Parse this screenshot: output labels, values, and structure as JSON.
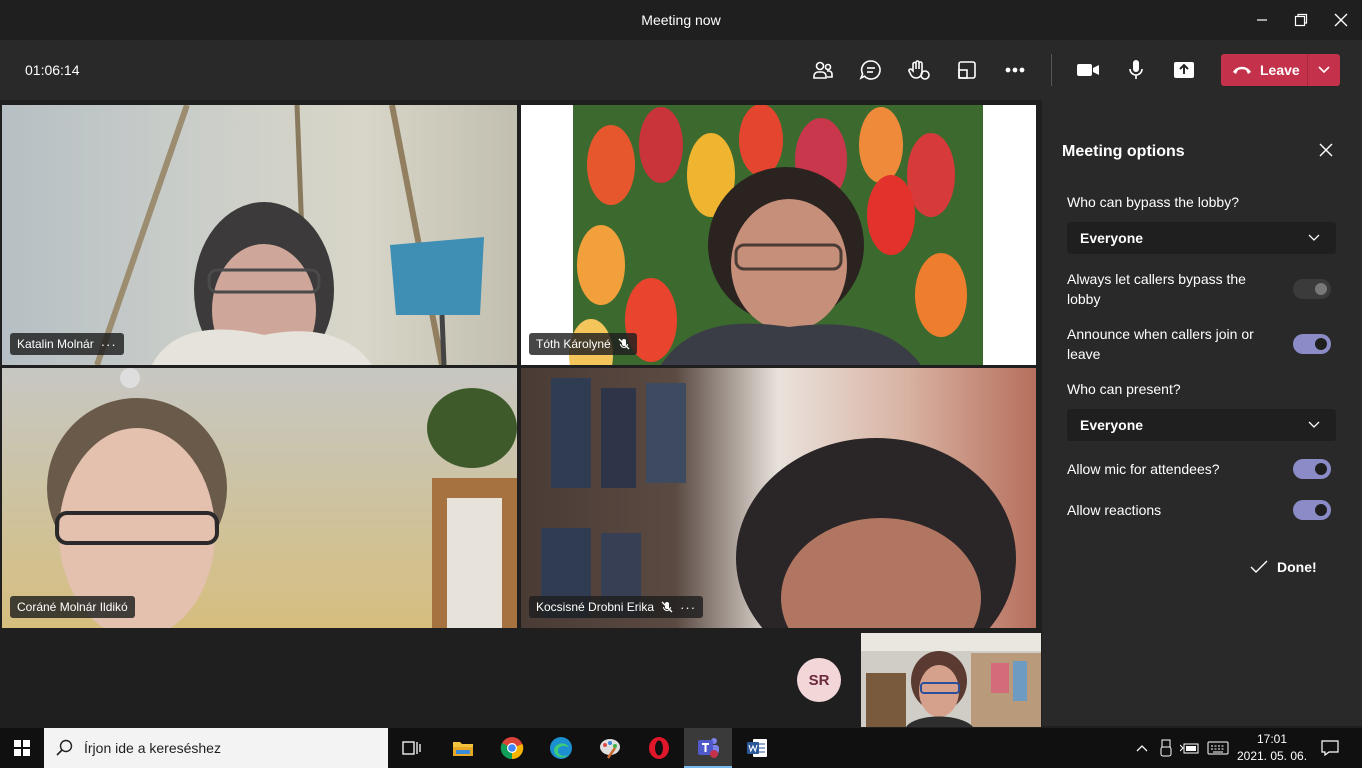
{
  "window": {
    "title": "Meeting now",
    "minimize_icon": "minimize-icon",
    "maximize_icon": "maximize-icon",
    "close_icon": "close-icon"
  },
  "toolbar": {
    "timer": "01:06:14",
    "icons": [
      "people-icon",
      "chat-icon",
      "raise-hand-icon",
      "breakout-rooms-icon",
      "more-options-icon",
      "camera-icon",
      "microphone-icon",
      "share-screen-icon"
    ],
    "leave_label": "Leave",
    "leave_color": "#c4314b"
  },
  "participants": [
    {
      "name": "Katalin Molnár",
      "muted": false,
      "has_menu": true
    },
    {
      "name": "Tóth Károlyné",
      "muted": true,
      "has_menu": false
    },
    {
      "name": "Coráné Molnár Ildikó",
      "muted": false,
      "has_menu": false
    },
    {
      "name": "Kocsisné Drobni Erika",
      "muted": true,
      "has_menu": true
    }
  ],
  "avatar_initials": "SR",
  "meeting_options": {
    "title": "Meeting options",
    "bypass_lobby_label": "Who can bypass the lobby?",
    "bypass_lobby_value": "Everyone",
    "callers_bypass_label": "Always let callers bypass the lobby",
    "callers_bypass_on": false,
    "announce_label": "Announce when callers join or leave",
    "announce_on": true,
    "present_label": "Who can present?",
    "present_value": "Everyone",
    "allow_mic_label": "Allow mic for attendees?",
    "allow_mic_on": true,
    "allow_reactions_label": "Allow reactions",
    "allow_reactions_on": true,
    "done_label": "Done!",
    "toggle_on_color": "#8b8cc7"
  },
  "taskbar": {
    "search_placeholder": "Írjon ide a kereséshez",
    "apps": [
      "task-view-icon",
      "file-explorer-icon",
      "chrome-icon",
      "edge-icon",
      "paint-icon",
      "opera-icon",
      "teams-icon",
      "word-icon"
    ],
    "time": "17:01",
    "date": "2021. 05. 06."
  }
}
